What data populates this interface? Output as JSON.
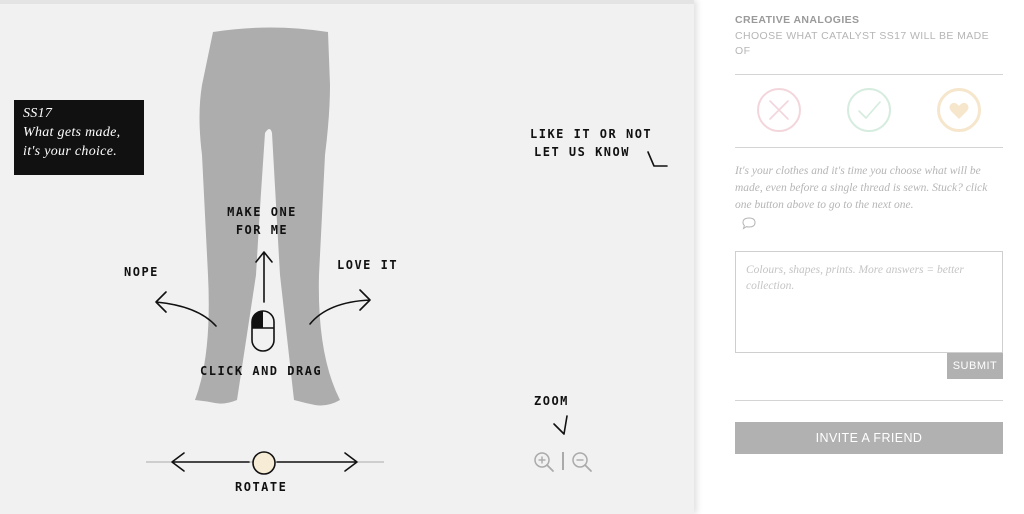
{
  "viewer": {
    "card": {
      "line1": "SS17",
      "line2": "What gets made,",
      "line3": "it's your choice."
    },
    "hints": {
      "feedback_line1": "LIKE IT OR NOT",
      "feedback_line2": "LET US KNOW",
      "make_line1": "MAKE ONE",
      "make_line2": "FOR ME",
      "nope": "NOPE",
      "love": "LOVE IT",
      "click_drag": "CLICK AND DRAG",
      "zoom": "ZOOM",
      "rotate": "ROTATE"
    },
    "product_color": "#adadad"
  },
  "panel": {
    "title": "CREATIVE ANALOGIES",
    "subtitle": "CHOOSE WHAT CATALYST SS17 WILL BE MADE OF",
    "votes": [
      {
        "name": "nope",
        "icon": "x-icon",
        "color": "#f3d6dc"
      },
      {
        "name": "make-one",
        "icon": "check-icon",
        "color": "#d5ecdf"
      },
      {
        "name": "love-it",
        "icon": "heart-icon",
        "color": "#f5e6cc"
      }
    ],
    "description": "It's your clothes and it's time you choose what will be made, even before a single thread is sewn. Stuck? click one button above to go to the next one.",
    "answer_placeholder": "Colours, shapes, prints. More answers = better collection.",
    "submit_label": "SUBMIT",
    "invite_label": "INVITE A FRIEND"
  }
}
